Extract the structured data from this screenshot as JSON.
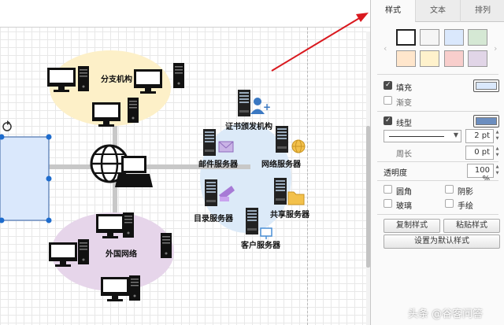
{
  "diagram": {
    "labels": {
      "branch": "分支机构",
      "foreign": "外国网络",
      "cert": "证书颁发机构",
      "mail": "邮件服务器",
      "web": "网络服务器",
      "dir": "目录服务器",
      "share": "共享服务器",
      "client": "客户服务器"
    },
    "colors": {
      "branch_ellipse": "#fdf0c8",
      "foreign_ellipse": "#e6d5ea",
      "server_ellipse": "#dceaf8",
      "selected_shape": "#dae8fc",
      "selection_handle": "#1e6ccd",
      "red_arrow": "#d9191f"
    }
  },
  "panel": {
    "tabs": [
      {
        "label": "样式",
        "active": true
      },
      {
        "label": "文本",
        "active": false
      },
      {
        "label": "排列",
        "active": false
      }
    ],
    "swatches": [
      {
        "icon": "swatch-white",
        "color": "#ffffff"
      },
      {
        "icon": "swatch-gray",
        "color": "#f5f5f5"
      },
      {
        "icon": "swatch-blue",
        "color": "#dae8fc"
      },
      {
        "icon": "swatch-green",
        "color": "#d5e8d4"
      },
      {
        "icon": "swatch-orange",
        "color": "#ffe6cc"
      },
      {
        "icon": "swatch-yellow",
        "color": "#fff2cc"
      },
      {
        "icon": "swatch-red",
        "color": "#f8cecc"
      },
      {
        "icon": "swatch-purple",
        "color": "#e1d5e7"
      }
    ],
    "fill": {
      "label": "填充",
      "checked": true,
      "color": "#dae8fc"
    },
    "gradient": {
      "label": "渐变",
      "checked": false
    },
    "line": {
      "label": "线型",
      "checked": true,
      "color": "#6c8ebf",
      "width_value": "2 pt"
    },
    "perimeter": {
      "label": "周长",
      "value": "0 pt"
    },
    "opacity": {
      "label": "透明度",
      "value": "100 %"
    },
    "options": [
      {
        "label": "圆角",
        "checked": false
      },
      {
        "label": "阴影",
        "checked": false
      },
      {
        "label": "玻璃",
        "checked": false
      },
      {
        "label": "手绘",
        "checked": false
      }
    ],
    "buttons": {
      "copy_style": "复制样式",
      "paste_style": "粘贴样式",
      "set_default": "设置为默认样式"
    }
  },
  "watermark": "头条 @谷客问答"
}
